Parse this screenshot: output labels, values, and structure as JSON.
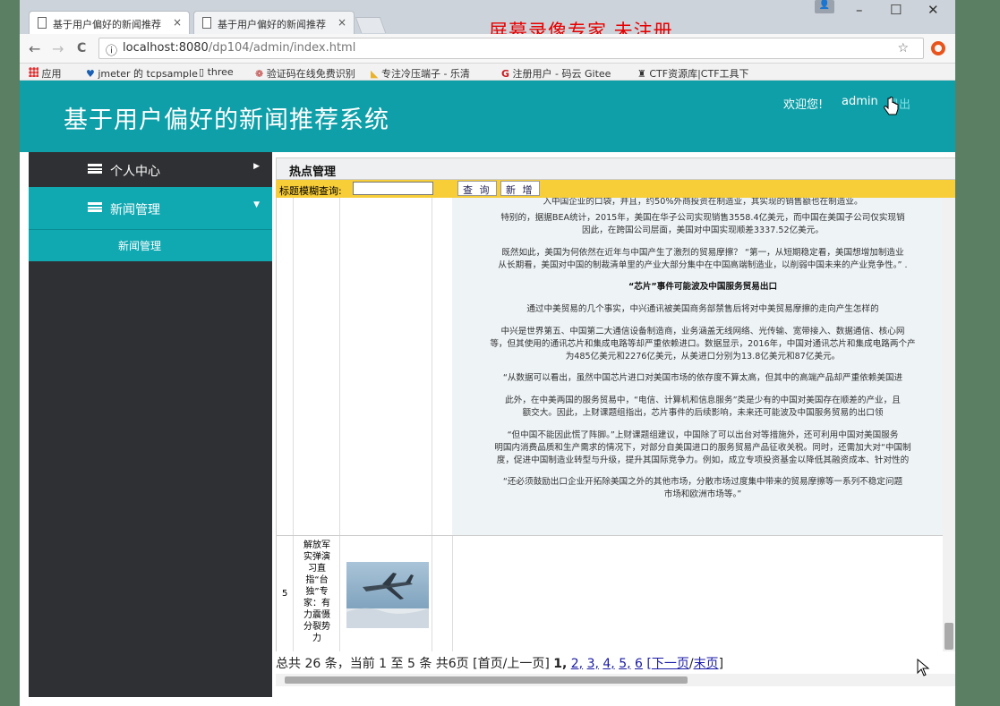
{
  "browser": {
    "tabs": [
      {
        "label": "基于用户偏好的新闻推荐"
      },
      {
        "label": "基于用户偏好的新闻推荐"
      }
    ],
    "tab_close": "×",
    "watermark": "屏幕录像专家 未注册",
    "window_buttons": {
      "minimize": "–",
      "maximize": "☐",
      "close": "✕"
    },
    "nav": {
      "back": "←",
      "forward": "→",
      "reload": "C"
    },
    "url_host": "localhost:8080",
    "url_path": "/dp104/admin/index.html",
    "bookmarks": [
      "应用",
      "jmeter 的 tcpsample",
      "three",
      "验证码在线免费识别",
      "专注冷压端子 - 乐清",
      "注册用户 - 码云 Gitee",
      "CTF资源库|CTF工具下"
    ]
  },
  "header": {
    "title": "基于用户偏好的新闻推荐系统",
    "welcome": "欢迎您!",
    "username": "admin",
    "logout": "退出"
  },
  "sidebar": {
    "items": [
      {
        "label": "个人中心",
        "arrow": "▶"
      },
      {
        "label": "新闻管理",
        "arrow": "▼"
      }
    ],
    "submenu": [
      {
        "label": "新闻管理"
      }
    ]
  },
  "content": {
    "title": "热点管理",
    "search_label": "标题模糊查询:",
    "search_value": "",
    "search_button": "查 询",
    "add_button": "新 增",
    "article_paragraphs": [
      "入中国企业的口袋，并且，约50%外商投资在制造业，其实现的销售额也在制造业。",
      "特别的，据据BEA统计，2015年，美国在华子公司实现销售3558.4亿美元，而中国在美国子公司仅实现销",
      "因此，在跨国公司层面，美国对中国实现顺差3337.52亿美元。",
      "既然如此，美国为何依然在近年与中国产生了激烈的贸易摩擦？ “第一，从短期稳定看，美国想增加制造业",
      "从长期看，美国对中国的制裁清单里的产业大部分集中在中国高端制造业，以削弱中国未来的产业竞争性。” .",
      "“芯片”事件可能波及中国服务贸易出口",
      "通过中美贸易的几个事实，中兴通讯被美国商务部禁售后将对中美贸易摩擦的走向产生怎样的",
      "中兴是世界第五、中国第二大通信设备制造商，业务涵盖无线网络、光传输、宽带接入、数据通信、核心网",
      "等，但其使用的通讯芯片和集成电路等却严重依赖进口。数据显示，2016年，中国对通讯芯片和集成电路两个产",
      "为485亿美元和2276亿美元，从美进口分别为13.8亿美元和87亿美元。",
      "“从数据可以看出，虽然中国芯片进口对美国市场的依存度不算太高，但其中的高端产品却严重依赖美国进",
      "此外，在中美两国的服务贸易中，“电信、计算机和信息服务”类是少有的中国对美国存在顺差的产业，且",
      "额交大。因此，上财课题组指出，芯片事件的后续影响，未来还可能波及中国服务贸易的出口领",
      "“但中国不能因此慌了阵脚。”上财课题组建议，中国除了可以出台对等措施外，还可利用中国对美国服务",
      "明国内消费品质和生产需求的情况下，对部分自美国进口的服务贸易产品征收关税。同时，还需加大对“中国制",
      "度，促进中国制造业转型与升级，提升其国际竞争力。例如，成立专项投资基金以降低其融资成本、针对性的",
      "“还必须鼓励出口企业开拓除美国之外的其他市场，分散市场过度集中带来的贸易摩擦等一系列不稳定问题",
      "市场和欧洲市场等。”"
    ],
    "row5": {
      "number": "5",
      "title": "解放军实弹演习直指“台独”专家：有力震慑分裂势力"
    },
    "pagination": {
      "summary": "总共 26 条，当前 1 至 5 条 共6页",
      "first_prev": "[首页/上一页]",
      "current": "1,",
      "pages": [
        "2,",
        "3,",
        "4,",
        "5,",
        "6"
      ],
      "next_last_open": "[",
      "next": "下一页",
      "sep": "/",
      "last": "末页",
      "close": "]"
    }
  },
  "colors": {
    "header": "#0f9fa8",
    "sidebar": "#2f3033",
    "search_bar": "#f7cd38",
    "watermark": "#e60000"
  }
}
